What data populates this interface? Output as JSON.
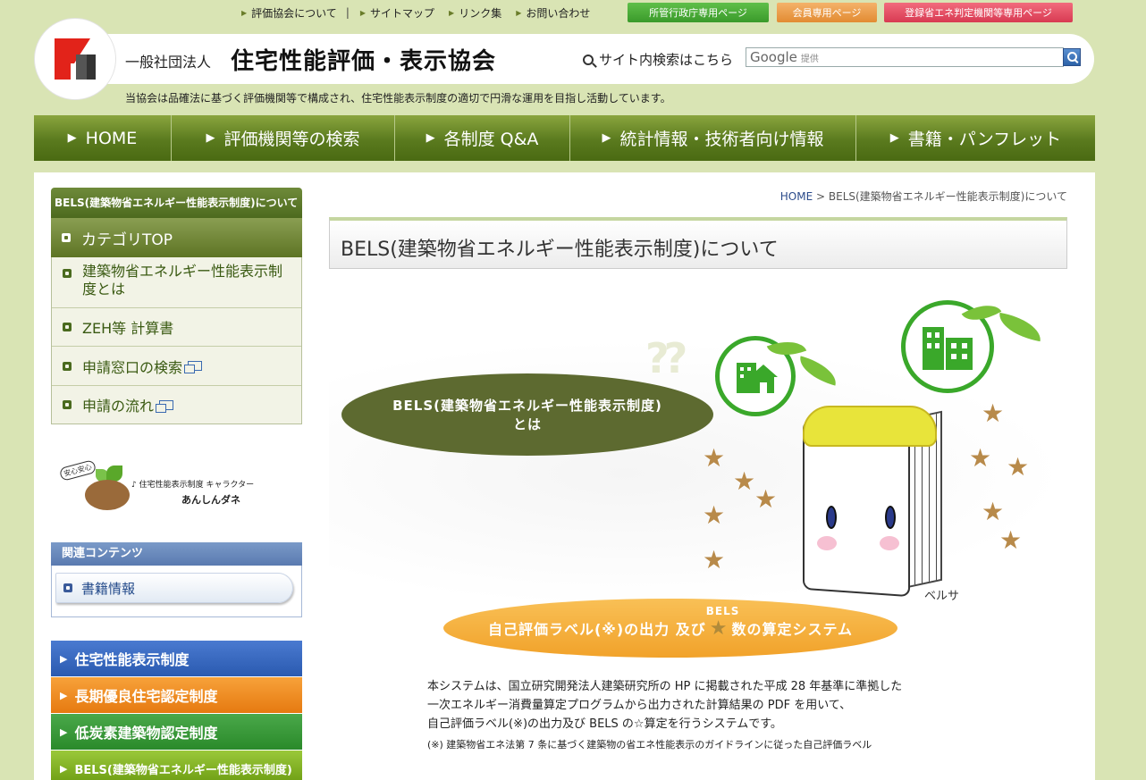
{
  "top_links": [
    {
      "label": "評価協会について"
    },
    {
      "label": "サイトマップ"
    },
    {
      "label": "リンク集"
    },
    {
      "label": "お問い合わせ"
    }
  ],
  "top_buttons": {
    "gov": "所管行政庁専用ページ",
    "member": "会員専用ページ",
    "registered": "登録省エネ判定機関等専用ページ"
  },
  "header": {
    "org_prefix": "一般社団法人",
    "org_name": "住宅性能評価・表示協会",
    "tagline": "当協会は品確法に基づく評価機関等で構成され、住宅性能表示制度の適切で円滑な運用を目指し活動しています。",
    "site_search_label": "サイト内検索はこちら",
    "search_brand": "Google",
    "search_brand_suffix": "提供"
  },
  "nav": [
    "HOME",
    "評価機関等の検索",
    "各制度 Q&A",
    "統計情報・技術者向け情報",
    "書籍・パンフレット"
  ],
  "sidebar": {
    "heading": "BELS(建築物省エネルギー性能表示制度)について",
    "category_top": "カテゴリTOP",
    "items": [
      {
        "label": "建築物省エネルギー性能表示制度とは",
        "external": false
      },
      {
        "label": "ZEH等 計算書",
        "external": false
      },
      {
        "label": "申請窓口の検索",
        "external": true
      },
      {
        "label": "申請の流れ",
        "external": true
      }
    ],
    "mascot": {
      "bubble": "安心安心",
      "caption": "住宅性能表示制度 キャラクター",
      "name": "あんしんダネ"
    },
    "related_heading": "関連コンテンツ",
    "related_item": "書籍情報",
    "systems": [
      "住宅性能表示制度",
      "長期優良住宅認定制度",
      "低炭素建築物認定制度",
      "BELS(建築物省エネルギー性能表示制度)"
    ]
  },
  "breadcrumb": {
    "home": "HOME",
    "sep": ">",
    "current": "BELS(建築物省エネルギー性能表示制度)について"
  },
  "page_title": "BELS(建築物省エネルギー性能表示制度)について",
  "illustration": {
    "oval_line1": "BELS(建築物省エネルギー性能表示制度)",
    "oval_line2": "とは",
    "character_name": "ベルサ",
    "system_prefix": "自己評価ラベル(※)の出力 及び",
    "system_sup": "BELS",
    "system_star": "★",
    "system_suffix": "数の算定システム"
  },
  "description": {
    "line1": "本システムは、国立研究開発法人建築研究所の HP に掲載された平成 28 年基準に準拠した",
    "line2": "一次エネルギー消費量算定プログラムから出力された計算結果の PDF を用いて、",
    "line3": "自己評価ラベル(※)の出力及び BELS の☆算定を行うシステムです。",
    "note": "(※) 建築物省エネ法第 7 条に基づく建築物の省エネ性能表示のガイドラインに従った自己評価ラベル"
  },
  "colors": {
    "page_bg": "#d9e4b4",
    "nav_green": "#5a7a1e",
    "oval_dark": "#5d6a30",
    "oval_orange": "#f1a22a"
  }
}
